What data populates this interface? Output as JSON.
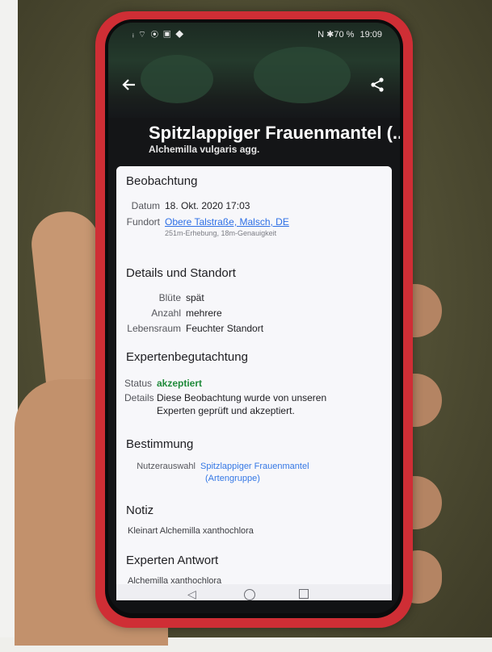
{
  "status_bar": {
    "left_icons": "ᵢ ⌔ ◉ ▣ ◆",
    "right_text": "N ✱70 %",
    "time": "19:09"
  },
  "header": {
    "title": "Spitzlappiger Frauenmantel (...",
    "subtitle": "Alchemilla vulgaris agg."
  },
  "sections": {
    "beobachtung": {
      "title": "Beobachtung",
      "date_label": "Datum",
      "date_value": "18. Okt. 2020 17:03",
      "location_label": "Fundort",
      "location_value": "Obere Talstraße, Malsch, DE",
      "location_meta": "251m-Erhebung, 18m-Genauigkeit"
    },
    "details": {
      "title": "Details und Standort",
      "rows": [
        {
          "label": "Blüte",
          "value": "spät"
        },
        {
          "label": "Anzahl",
          "value": "mehrere"
        },
        {
          "label": "Lebensraum",
          "value": "Feuchter Standort"
        }
      ]
    },
    "experten": {
      "title": "Expertenbegutachtung",
      "status_label": "Status",
      "status_value": "akzeptiert",
      "details_label": "Details",
      "details_line1": "Diese Beobachtung wurde von unseren",
      "details_line2": "Experten geprüft und akzeptiert."
    },
    "bestimmung": {
      "title": "Bestimmung",
      "user_label": "Nutzerauswahl",
      "user_value_line1": "Spitzlappiger Frauenmantel",
      "user_value_line2": "(Artengruppe)"
    },
    "notiz": {
      "title": "Notiz",
      "text": "Kleinart Alchemilla xanthochlora"
    },
    "antwort": {
      "title": "Experten Antwort",
      "text": "Alchemilla xanthochlora"
    }
  },
  "icons": {
    "back": "arrow-left-icon",
    "share": "share-icon",
    "nav_back": "triangle-back-icon",
    "nav_home": "circle-home-icon",
    "nav_recent": "square-recent-icon"
  }
}
